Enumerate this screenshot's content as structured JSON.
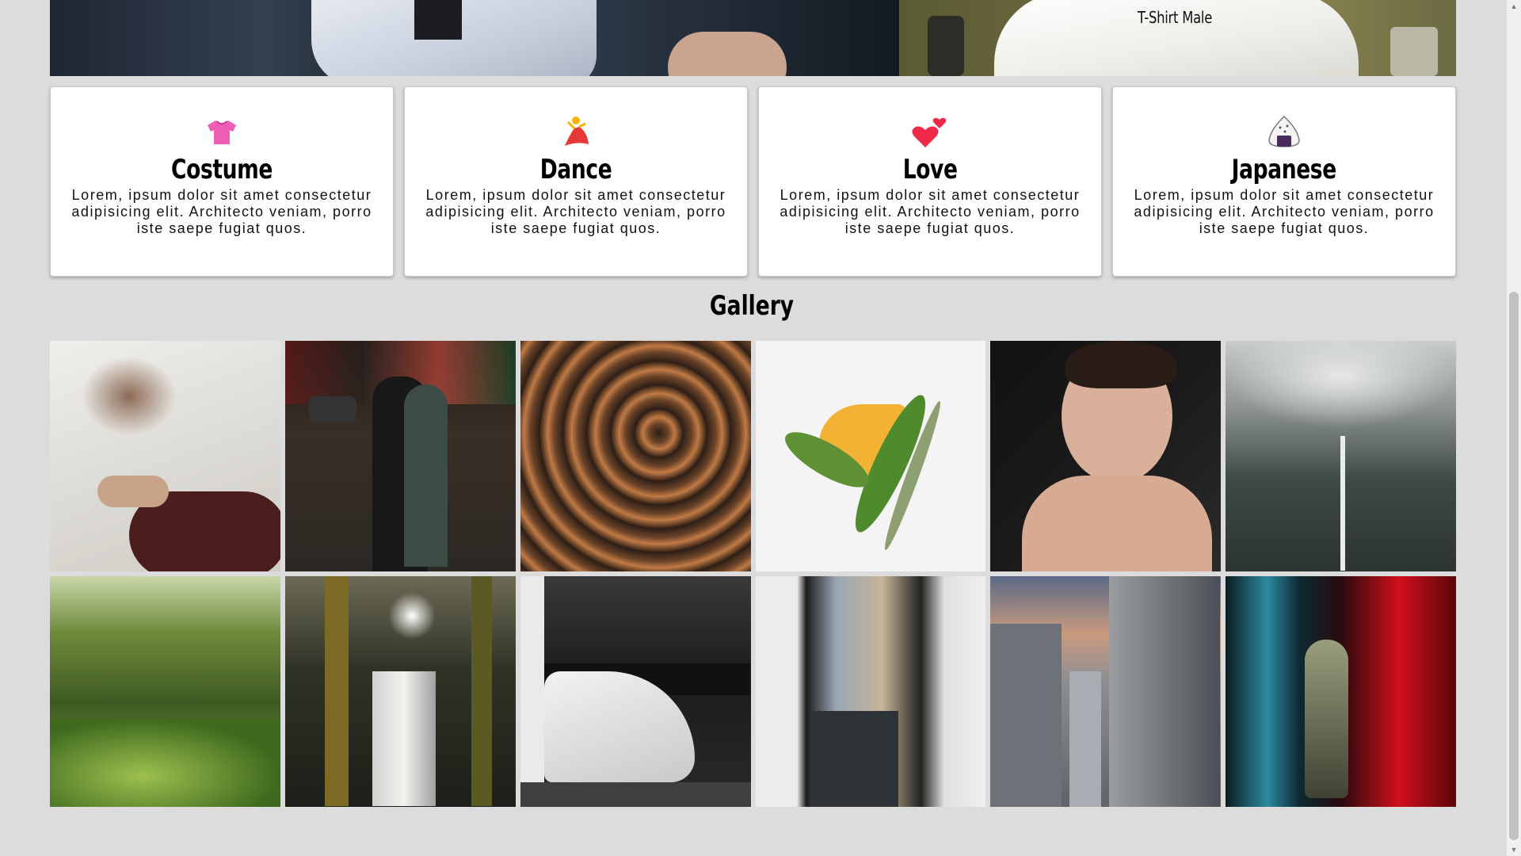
{
  "hero": {
    "caption": "T-Shirt Male"
  },
  "cards": [
    {
      "icon": "t-shirt-icon",
      "title": "Costume",
      "text": "Lorem, ipsum dolor sit amet consectetur adipisicing elit. Architecto veniam, porro iste saepe fugiat quos."
    },
    {
      "icon": "dancer-icon",
      "title": "Dance",
      "text": "Lorem, ipsum dolor sit amet consectetur adipisicing elit. Architecto veniam, porro iste saepe fugiat quos."
    },
    {
      "icon": "two-hearts-icon",
      "title": "Love",
      "text": "Lorem, ipsum dolor sit amet consectetur adipisicing elit. Architecto veniam, porro iste saepe fugiat quos."
    },
    {
      "icon": "rice-ball-icon",
      "title": "Japanese",
      "text": "Lorem, ipsum dolor sit amet consectetur adipisicing elit. Architecto veniam, porro iste saepe fugiat quos."
    }
  ],
  "gallery": {
    "title": "Gallery",
    "images": [
      "yoga-hands-photo",
      "couple-night-street-photo",
      "abstract-waves-photo",
      "lily-flower-photo",
      "man-portrait-photo",
      "misty-waterfall-mountain-photo",
      "fern-canyon-photo",
      "forest-waterfall-photo",
      "white-car-garage-photo",
      "narrow-alley-photo",
      "baroque-architecture-photo",
      "astronaut-neon-photo"
    ]
  },
  "colors": {
    "background": "#dcdcdc",
    "card": "#ffffff",
    "text": "#000000"
  }
}
